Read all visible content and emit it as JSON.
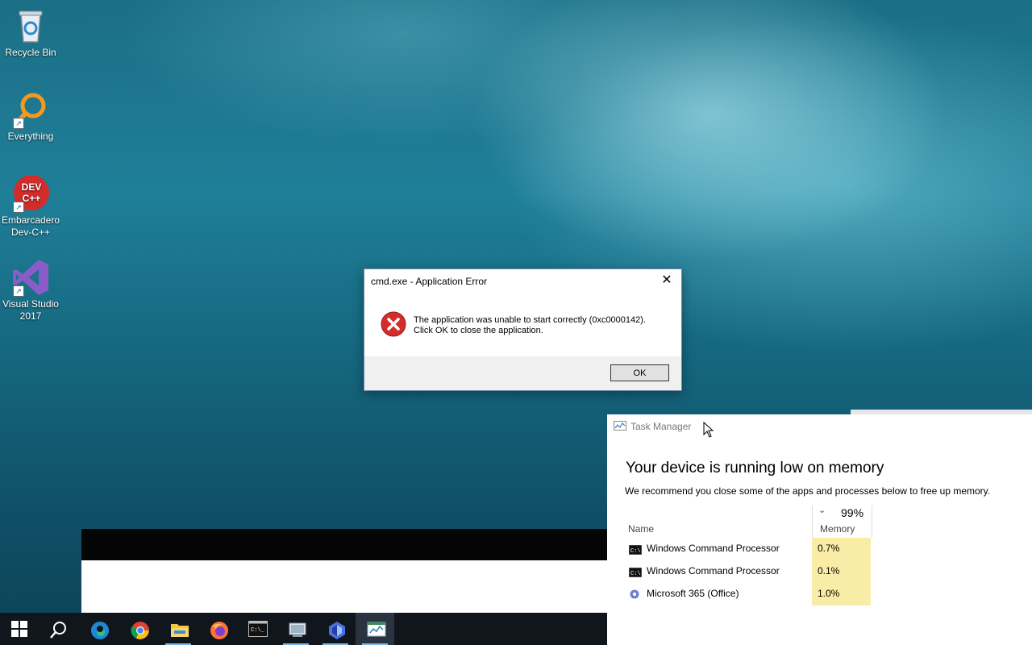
{
  "desktop": {
    "icons": [
      {
        "label": "Recycle Bin"
      },
      {
        "label": "Everything"
      },
      {
        "label": "Embarcadero Dev-C++",
        "badge": "DEV C++"
      },
      {
        "label": "Visual Studio 2017"
      }
    ]
  },
  "error_dialog": {
    "title": "cmd.exe - Application Error",
    "message_line1": "The application was unable to start correctly (0xc0000142).",
    "message_line2": "Click OK to close the application.",
    "ok_label": "OK",
    "close_glyph": "✕"
  },
  "task_manager": {
    "window_title": "Task Manager",
    "heading": "Your device is running low on memory",
    "subtitle": "We recommend you close some of the apps and processes below to free up memory.",
    "memory_total": "99%",
    "columns": {
      "name": "Name",
      "memory": "Memory"
    },
    "rows": [
      {
        "name": "Windows Command Processor",
        "memory": "0.7%",
        "icon": "cmd-icon"
      },
      {
        "name": "Windows Command Processor",
        "memory": "0.1%",
        "icon": "cmd-icon"
      },
      {
        "name": "Microsoft 365 (Office)",
        "memory": "1.0%",
        "icon": "office-icon"
      }
    ],
    "highlight_color": "#f9eca6"
  },
  "taskbar": {
    "items": [
      "start",
      "search",
      "edge",
      "chrome",
      "file-explorer",
      "firefox",
      "terminal",
      "control-panel",
      "copilot",
      "task-manager"
    ]
  }
}
